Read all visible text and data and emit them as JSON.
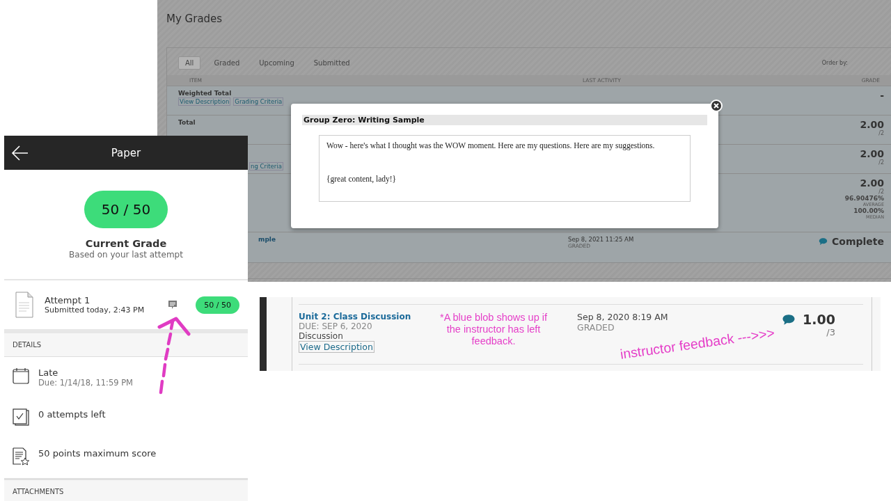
{
  "grades_page": {
    "title": "My Grades",
    "tabs": [
      {
        "label": "All",
        "selected": true
      },
      {
        "label": "Graded",
        "selected": false
      },
      {
        "label": "Upcoming",
        "selected": false
      },
      {
        "label": "Submitted",
        "selected": false
      }
    ],
    "order_by": "Order by:",
    "columns": [
      "ITEM",
      "LAST ACTIVITY",
      "GRADE"
    ],
    "rows": [
      {
        "item": "Weighted Total",
        "links": [
          "View Description",
          "Grading Criteria"
        ],
        "grade": "-"
      },
      {
        "item": "Total",
        "grade": "2.00",
        "out_of": "/2"
      },
      {
        "links": [
          "ng Criteria"
        ],
        "grade": "2.00",
        "out_of": "/2"
      },
      {
        "grade": "2.00",
        "out_of": "/2",
        "stats": [
          {
            "value": "96.90476%",
            "label": "AVERAGE"
          },
          {
            "value": "100.00%",
            "label": "MEDIAN"
          }
        ]
      },
      {
        "item_link": "mple",
        "activity": "Sep 8, 2021 11:25 AM",
        "status": "GRADED",
        "grade": "Complete",
        "feedback": true
      }
    ],
    "modal": {
      "title": "Group Zero: Writing Sample",
      "paragraphs": [
        "Wow - here's what I thought was the WOW moment. Here are my questions. Here are my suggestions.",
        "{great content, lady!}"
      ]
    }
  },
  "mobile": {
    "title": "Paper",
    "grade": "50 / 50",
    "grade_label": "Current Grade",
    "grade_note": "Based on your last attempt",
    "attempt": {
      "title": "Attempt 1",
      "submitted": "Submitted today, 2:43 PM",
      "grade": "50 / 50",
      "feedback": true
    },
    "details_header": "DETAILS",
    "details": [
      {
        "kind": "calendar",
        "title": "Late",
        "subtitle": "Due: 1/14/18, 11:59 PM"
      },
      {
        "kind": "attempts",
        "title": "0 attempts left"
      },
      {
        "kind": "score",
        "title": "50 points maximum score"
      }
    ],
    "attachments_header": "ATTACHMENTS"
  },
  "discussion_row": {
    "title": "Unit 2: Class Discussion",
    "due": "DUE: SEP 6, 2020",
    "type": "Discussion",
    "link": "View Description",
    "activity": "Sep 8, 2020 8:19 AM",
    "status": "GRADED",
    "feedback": true,
    "grade": "1.00",
    "out_of": "/3"
  },
  "annotations": {
    "note": "*A blue blob shows up if the instructor has left feedback.",
    "label": "instructor feedback --->>>"
  }
}
